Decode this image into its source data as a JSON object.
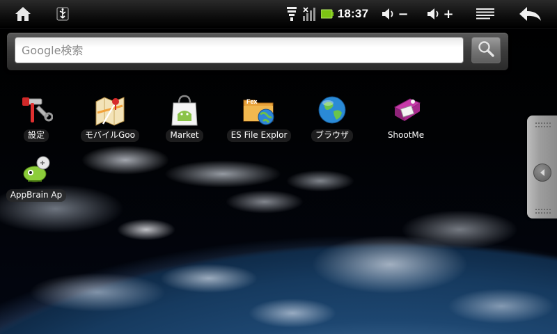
{
  "status_bar": {
    "home_icon": "home-icon",
    "usb_icon": "usb-icon",
    "wifi_icon": "wifi-icon",
    "signal_icon": "no-signal-icon",
    "battery_icon": "battery-icon",
    "clock": "18:37",
    "volume_down_icon": "volume-down-icon",
    "volume_up_icon": "volume-up-icon",
    "menu_icon": "menu-icon",
    "back_icon": "back-arrow-icon",
    "battery_color": "#7cc414"
  },
  "search": {
    "placeholder": "Google検索",
    "value": "",
    "button_icon": "magnifier-icon"
  },
  "apps": [
    {
      "label": "設定",
      "icon": "settings-tools-icon"
    },
    {
      "label": "モバイルGoo",
      "icon": "maps-icon"
    },
    {
      "label": "Market",
      "icon": "market-bag-icon"
    },
    {
      "label": "ES File Explor",
      "icon": "folder-globe-icon"
    },
    {
      "label": "ブラウザ",
      "icon": "globe-icon"
    },
    {
      "label": "ShootMe",
      "icon": "camera-icon"
    },
    {
      "label": "AppBrain Ap",
      "icon": "appbrain-icon"
    }
  ],
  "drawer": {
    "icon": "chevron-left-icon"
  }
}
